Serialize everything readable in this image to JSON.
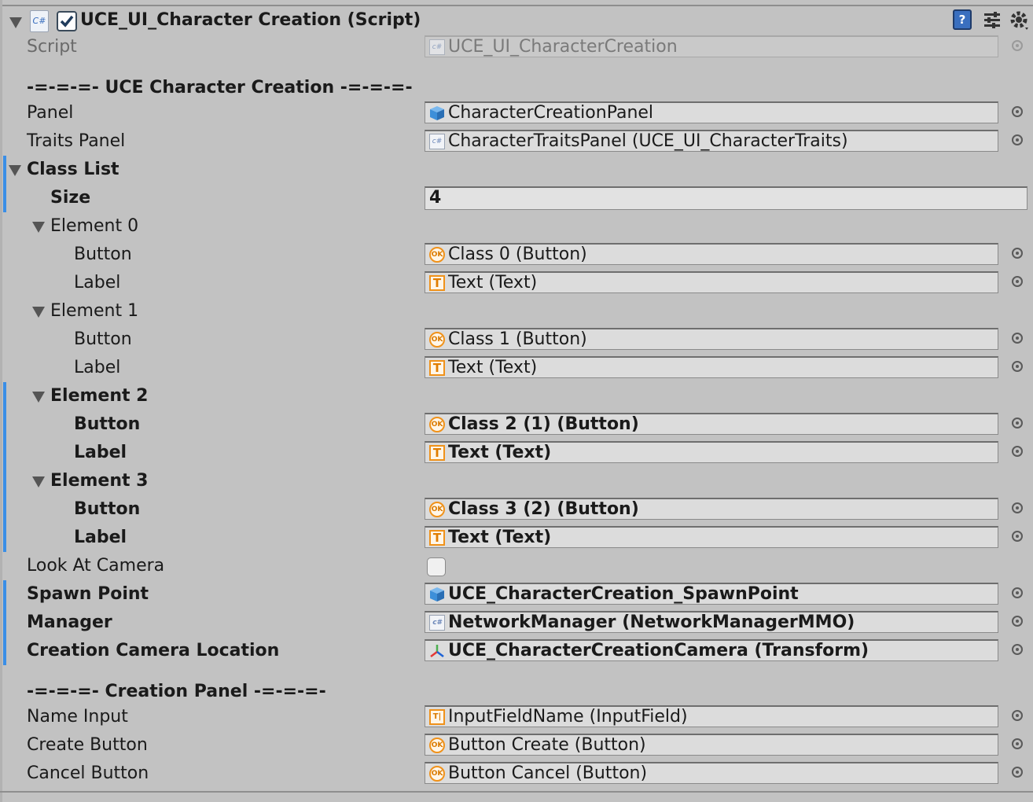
{
  "header": {
    "title": "UCE_UI_Character Creation (Script)",
    "enabled": true,
    "script_icon": "c# script-icon",
    "icons": [
      "help-book-icon",
      "preset-sliders-icon",
      "gear-menu-icon"
    ]
  },
  "script": {
    "label": "Script",
    "value": "UCE_UI_CharacterCreation"
  },
  "section1": {
    "header": "-=-=-=- UCE Character Creation -=-=-=-"
  },
  "panel": {
    "label": "Panel",
    "value": "CharacterCreationPanel",
    "icon": "cube-icon"
  },
  "traits_panel": {
    "label": "Traits Panel",
    "value": "CharacterTraitsPanel (UCE_UI_CharacterTraits)",
    "icon": "script-icon"
  },
  "class_list": {
    "label": "Class List",
    "size_label": "Size",
    "size_value": "4",
    "elements": [
      {
        "label": "Element 0",
        "button_label": "Button",
        "button_value": "Class 0 (Button)",
        "label_label": "Label",
        "label_value": "Text (Text)"
      },
      {
        "label": "Element 1",
        "button_label": "Button",
        "button_value": "Class 1 (Button)",
        "label_label": "Label",
        "label_value": "Text (Text)"
      },
      {
        "label": "Element 2",
        "button_label": "Button",
        "button_value": "Class 2 (1) (Button)",
        "label_label": "Label",
        "label_value": "Text (Text)"
      },
      {
        "label": "Element 3",
        "button_label": "Button",
        "button_value": "Class 3 (2) (Button)",
        "label_label": "Label",
        "label_value": "Text (Text)"
      }
    ]
  },
  "look_at_camera": {
    "label": "Look At Camera",
    "checked": false
  },
  "spawn_point": {
    "label": "Spawn Point",
    "value": "UCE_CharacterCreation_SpawnPoint",
    "icon": "cube-icon"
  },
  "manager": {
    "label": "Manager",
    "value": "NetworkManager (NetworkManagerMMO)",
    "icon": "script-icon"
  },
  "camera_location": {
    "label": "Creation Camera Location",
    "value": "UCE_CharacterCreationCamera (Transform)",
    "icon": "transform-axes-icon"
  },
  "section2": {
    "header": "-=-=-=- Creation Panel -=-=-=-"
  },
  "name_input": {
    "label": "Name Input",
    "value": "InputFieldName (InputField)",
    "icon": "input-field-icon"
  },
  "create_button": {
    "label": "Create Button",
    "value": "Button Create (Button)",
    "icon": "button-ok-icon"
  },
  "cancel_button": {
    "label": "Cancel Button",
    "value": "Button Cancel (Button)",
    "icon": "button-ok-icon"
  },
  "colors": {
    "background": "#c2c2c2",
    "modified_bar": "#3a8ee6",
    "object_icon_orange": "#f0921a",
    "cube_blue": "#3d8fd9"
  }
}
